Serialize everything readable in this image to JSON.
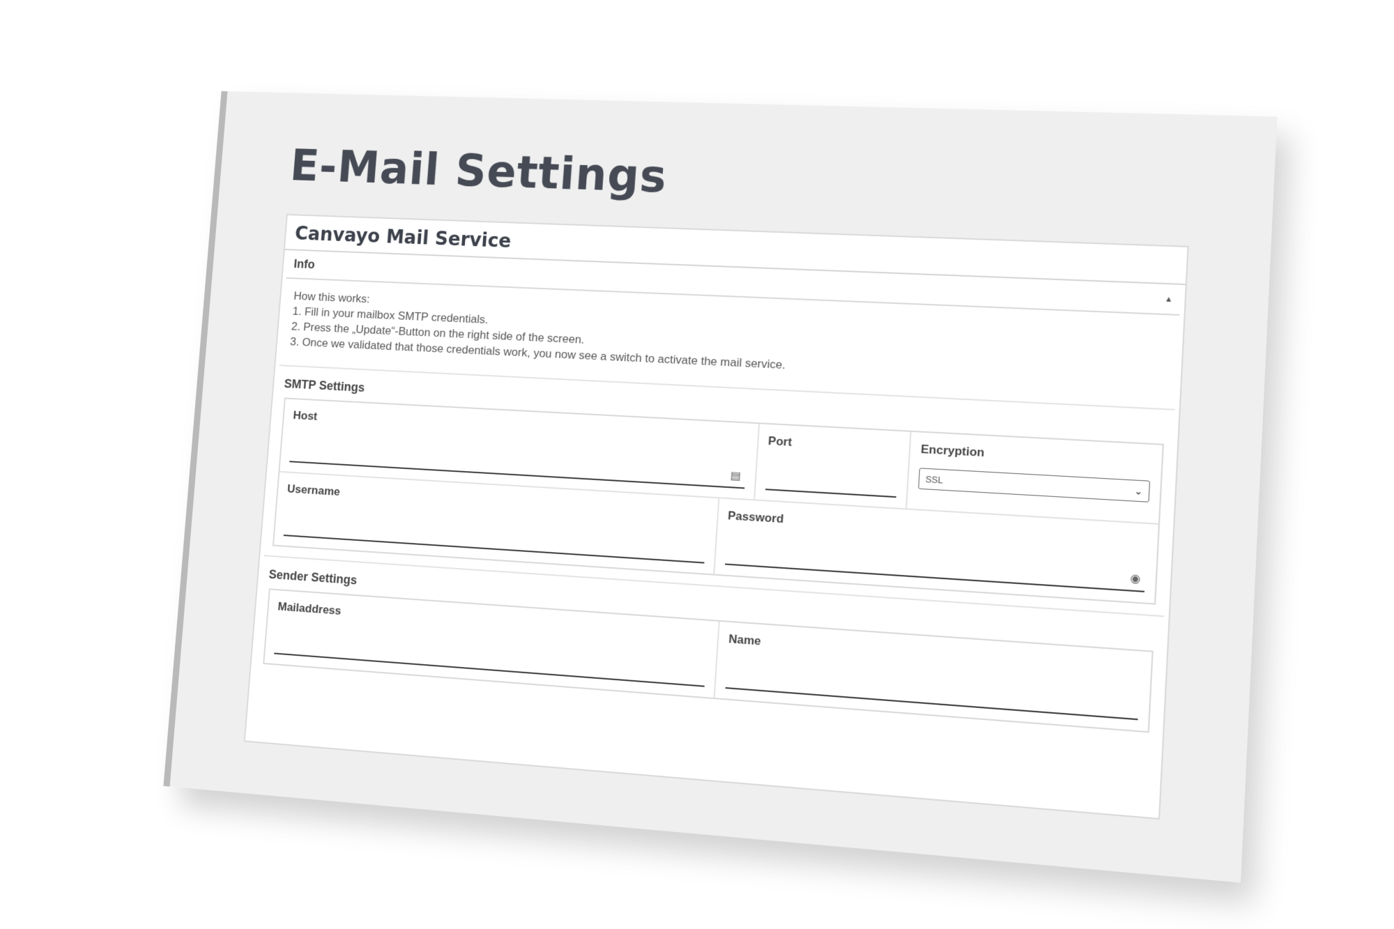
{
  "page": {
    "title": "E-Mail Settings"
  },
  "card": {
    "title": "Canvayo Mail Service"
  },
  "info": {
    "label": "Info",
    "collapse_symbol": "▲",
    "lines": [
      "How this works:",
      "1. Fill in your mailbox SMTP credentials.",
      "2. Press the „Update“-Button on the right side of the screen.",
      "3. Once we validated that those credentials work, you now see a switch to activate the mail service."
    ]
  },
  "smtp": {
    "title": "SMTP Settings",
    "host_label": "Host",
    "host_icon": "▤",
    "port_label": "Port",
    "encryption_label": "Encryption",
    "encryption_value": "SSL",
    "encryption_chevron": "⌄",
    "username_label": "Username",
    "password_label": "Password",
    "password_icon": "◉"
  },
  "sender": {
    "title": "Sender Settings",
    "mailaddress_label": "Mailaddress",
    "name_label": "Name"
  },
  "colors": {
    "panel_bg": "#efefef",
    "title_text": "#454a55",
    "card_bg": "#ffffff"
  }
}
